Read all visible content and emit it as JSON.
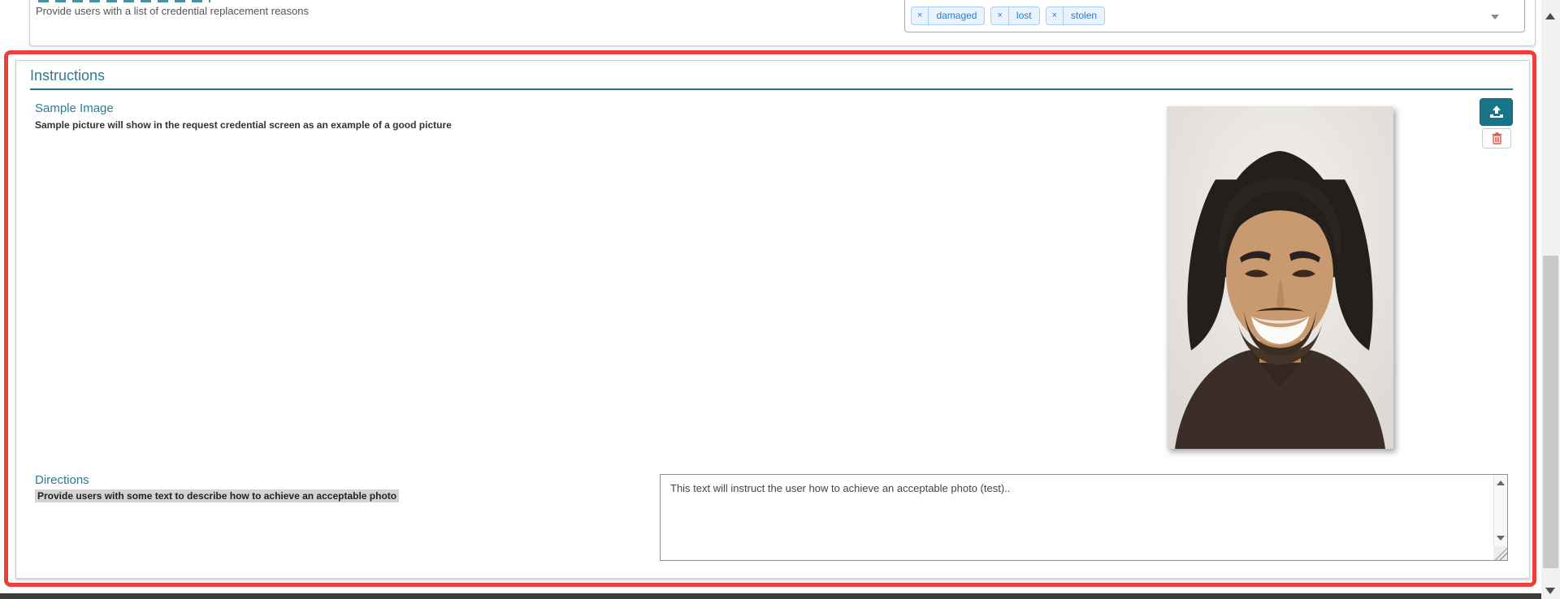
{
  "top_section": {
    "label": "Provide users with a list of credential replacement reasons",
    "remove_glyph": "×",
    "tags": [
      "damaged",
      "lost",
      "stolen"
    ]
  },
  "instructions_panel": {
    "title": "Instructions",
    "sample_image": {
      "title": "Sample Image",
      "description": "Sample picture will show in the request credential screen as an example of a good picture",
      "photo": "portrait of a smiling man with long dark hair and brown t-shirt"
    },
    "directions": {
      "title": "Directions",
      "description": "Provide users with some text to describe how to achieve an acceptable photo",
      "textarea_value": "This text will instruct the user how to achieve an acceptable photo (test).."
    }
  },
  "icons": {
    "upload": "upload-icon",
    "trash": "trash-icon",
    "chevron": "chevron-down-icon"
  },
  "colors": {
    "accent_teal": "#2a7e92",
    "button_teal": "#19748a",
    "panel_red": "#ee3f3d",
    "tag_blue_text": "#3178c6",
    "tag_blue_bg": "#e9f3fd",
    "tag_blue_border": "#a9cdf0",
    "trash_red": "#e2574c",
    "highlight_gray": "#d3d3d3"
  }
}
